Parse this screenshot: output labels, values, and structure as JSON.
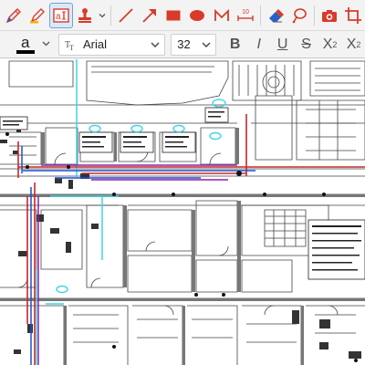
{
  "toolbar": {
    "tools": [
      {
        "name": "pen-tool",
        "icon": "pen-icon"
      },
      {
        "name": "highlighter-tool",
        "icon": "highlighter-icon"
      },
      {
        "name": "text-box-tool",
        "icon": "text-box-icon",
        "active": true
      },
      {
        "name": "stamp-tool",
        "icon": "stamp-icon"
      },
      {
        "name": "line-tool",
        "icon": "line-icon"
      },
      {
        "name": "arrow-tool",
        "icon": "arrow-icon"
      },
      {
        "name": "rectangle-tool",
        "icon": "rectangle-icon"
      },
      {
        "name": "ellipse-tool",
        "icon": "ellipse-icon"
      },
      {
        "name": "polyline-tool",
        "icon": "polyline-icon"
      },
      {
        "name": "measure-tool",
        "icon": "measure-icon"
      },
      {
        "name": "eraser-tool",
        "icon": "eraser-icon"
      },
      {
        "name": "lasso-tool",
        "icon": "lasso-icon"
      },
      {
        "name": "snapshot-tool",
        "icon": "camera-icon"
      },
      {
        "name": "crop-tool",
        "icon": "crop-icon"
      }
    ],
    "measure_label": "10",
    "accent_color": "#d83b2b"
  },
  "format_bar": {
    "text_color_icon_label": "a",
    "text_color_value": "#000000",
    "font_family_value": "Arial",
    "font_size_value": "32",
    "bold_label": "B",
    "italic_label": "I",
    "underline_label": "U",
    "strike_label": "S",
    "subscript_label": "X",
    "subscript_suffix": "2",
    "superscript_label": "X",
    "superscript_suffix": "2"
  },
  "canvas": {
    "document": "architectural floor plan drawing",
    "line_color": "#404040",
    "highlight_colors": [
      "#3fd4e8",
      "#c62828",
      "#1e4fd0",
      "#8e24aa"
    ]
  }
}
